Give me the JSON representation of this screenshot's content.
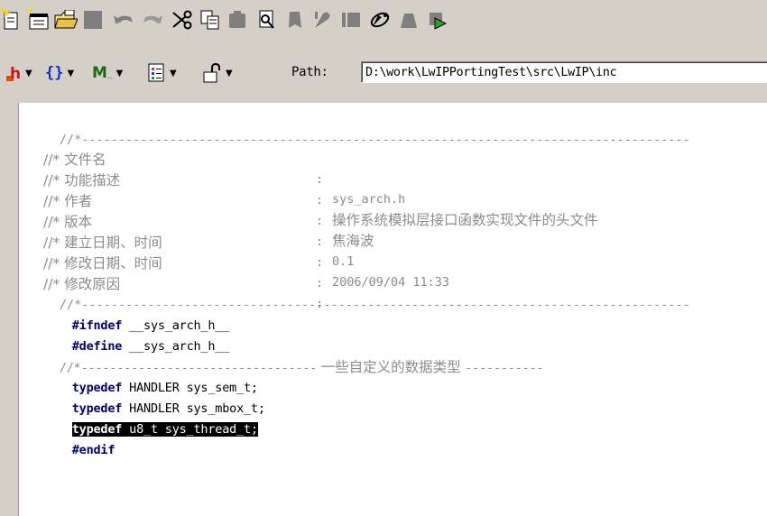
{
  "toolbar_top": {
    "buttons": [
      "new-file-icon",
      "new-project-icon",
      "open-folder-icon",
      "save-icon",
      "undo-icon",
      "redo-icon",
      "cut-icon",
      "copy-icon",
      "paste-icon",
      "find-icon",
      "bookmark-icon",
      "tools-icon",
      "panel-icon",
      "settings-icon",
      "build-icon",
      "run-icon"
    ]
  },
  "toolbar_second": {
    "dropdowns": [
      {
        "icon": "h-file-icon",
        "glyph": "h"
      },
      {
        "icon": "braces-icon",
        "glyph": "{}"
      },
      {
        "icon": "macro-icon",
        "glyph": "M"
      },
      {
        "icon": "list-icon",
        "glyph": ""
      },
      {
        "icon": "lock-icon",
        "glyph": ""
      }
    ],
    "path_label": "Path:",
    "path_value": "D:\\work\\LwIPPortingTest\\src\\LwIP\\inc"
  },
  "editor": {
    "separator_prefix": "//*",
    "separator_dashes": "-----------------------------------------------------------------------------------",
    "header_fields": [
      {
        "label": "//* 文件名",
        "colon": ":",
        "value": "sys_arch.h"
      },
      {
        "label": "//* 功能描述",
        "colon": ":",
        "value": "操作系统模拟层接口函数实现文件的头文件"
      },
      {
        "label": "//* 作者",
        "colon": ":",
        "value": "焦海波"
      },
      {
        "label": "//* 版本",
        "colon": ":",
        "value": "0.1"
      },
      {
        "label": "//* 建立日期、时间",
        "colon": ":",
        "value": "2006/09/04 11:33"
      },
      {
        "label": "//* 修改日期、时间",
        "colon": ":",
        "value": ""
      },
      {
        "label": "//* 修改原因",
        "colon": ":",
        "value": ""
      }
    ],
    "ifndef_kw": "#ifndef",
    "ifndef_name": "__sys_arch_h__",
    "define_kw": "#define",
    "define_name": "__sys_arch_h__",
    "section_prefix": "//*---------------------------------",
    "section_title": "一些自定义的数据类型",
    "section_suffix": "-----------",
    "typedefs": [
      {
        "kw": "typedef",
        "rest": "HANDLER sys_sem_t;"
      },
      {
        "kw": "typedef",
        "rest": "HANDLER sys_mbox_t;"
      },
      {
        "kw": "typedef",
        "rest": "u8_t sys_thread_t;"
      }
    ],
    "endif_kw": "#endif",
    "colors": {
      "keyword": "#00007a",
      "comment": "#8c8c8c",
      "selection": "#000000"
    }
  }
}
